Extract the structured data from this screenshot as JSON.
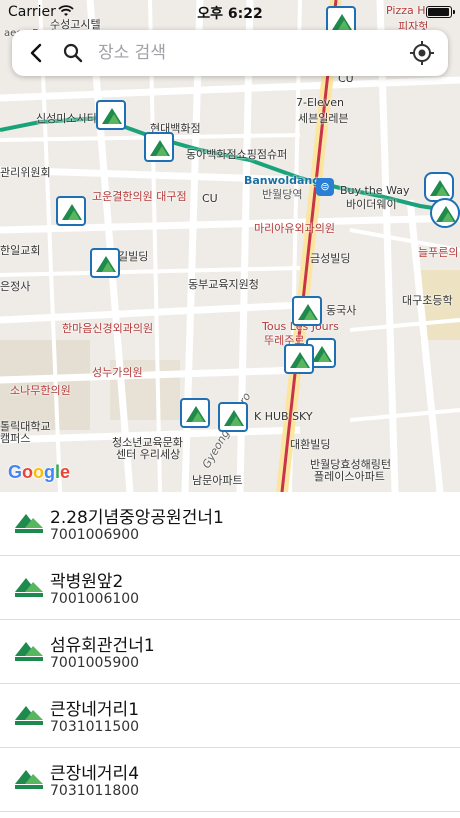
{
  "status_bar": {
    "carrier": "Carrier",
    "time": "오후 6:22",
    "battery_level": 1.0
  },
  "search": {
    "placeholder": "장소 검색"
  },
  "map": {
    "labels": {
      "top_station": "수성고시텔",
      "daegu_bank": "aegu Bank",
      "pizza": "Pizza H",
      "pizza_ko": "피자헛",
      "cu_top": "CU",
      "seven_eleven": "7-Eleven",
      "seven_eleven_ko": "세븐일레븐",
      "sinsung": "신성미소시티",
      "hyundai_dept": "현대백화점",
      "dongah": "동아백화점쇼핑점슈퍼",
      "banwoldang": "Banwoldang",
      "banwoldang_ko": "반월당역",
      "buy_the_way": "Buy the Way",
      "buy_the_way_ko": "바이더웨이",
      "committee": "관리위원회",
      "goeun": "고운결한의원 대구점",
      "cu_mid": "CU",
      "marian": "마리아유외과의원",
      "hanil": "한일교회",
      "building_gil": "길빌딩",
      "geumseong": "금성빌딩",
      "neulpureun": "늘푸른의",
      "eunjeongsa": "은정사",
      "dongbu": "동부교육지원청",
      "donggooksa": "동국사",
      "daegu_elem": "대구초등학",
      "hanmaeum": "한마음신경외과의원",
      "tous_les_jours": "Tous Les Jours",
      "tous_ko": "뚜레주르",
      "seongnu": "성누가의원",
      "sonamu": "소나무한의원",
      "catholic": "톨릭대학교",
      "campus": "캠퍼스",
      "youth_center": "청소년교육문화",
      "youth_center2": "센터 우리세상",
      "khub": "K HUB SKY",
      "daehwan": "대환빌딩",
      "banwoldang_complex": "반월당효성해링턴",
      "place_apt": "플레이스아파트",
      "nambu_apt": "남문아파트",
      "road": "Gyeongnyun-ro"
    },
    "attribution": [
      "G",
      "o",
      "o",
      "g",
      "l",
      "e"
    ],
    "route_color": "#1aa37a",
    "line_color": "#c8344a",
    "pin_color": "#1f6fb5",
    "logo_green": "#1f8a4c"
  },
  "results": [
    {
      "name": "2.28기념중앙공원건너1",
      "code": "7001006900"
    },
    {
      "name": "곽병원앞2",
      "code": "7001006100"
    },
    {
      "name": "섬유회관건너1",
      "code": "7001005900"
    },
    {
      "name": "큰장네거리1",
      "code": "7031011500"
    },
    {
      "name": "큰장네거리4",
      "code": "7031011800"
    }
  ]
}
